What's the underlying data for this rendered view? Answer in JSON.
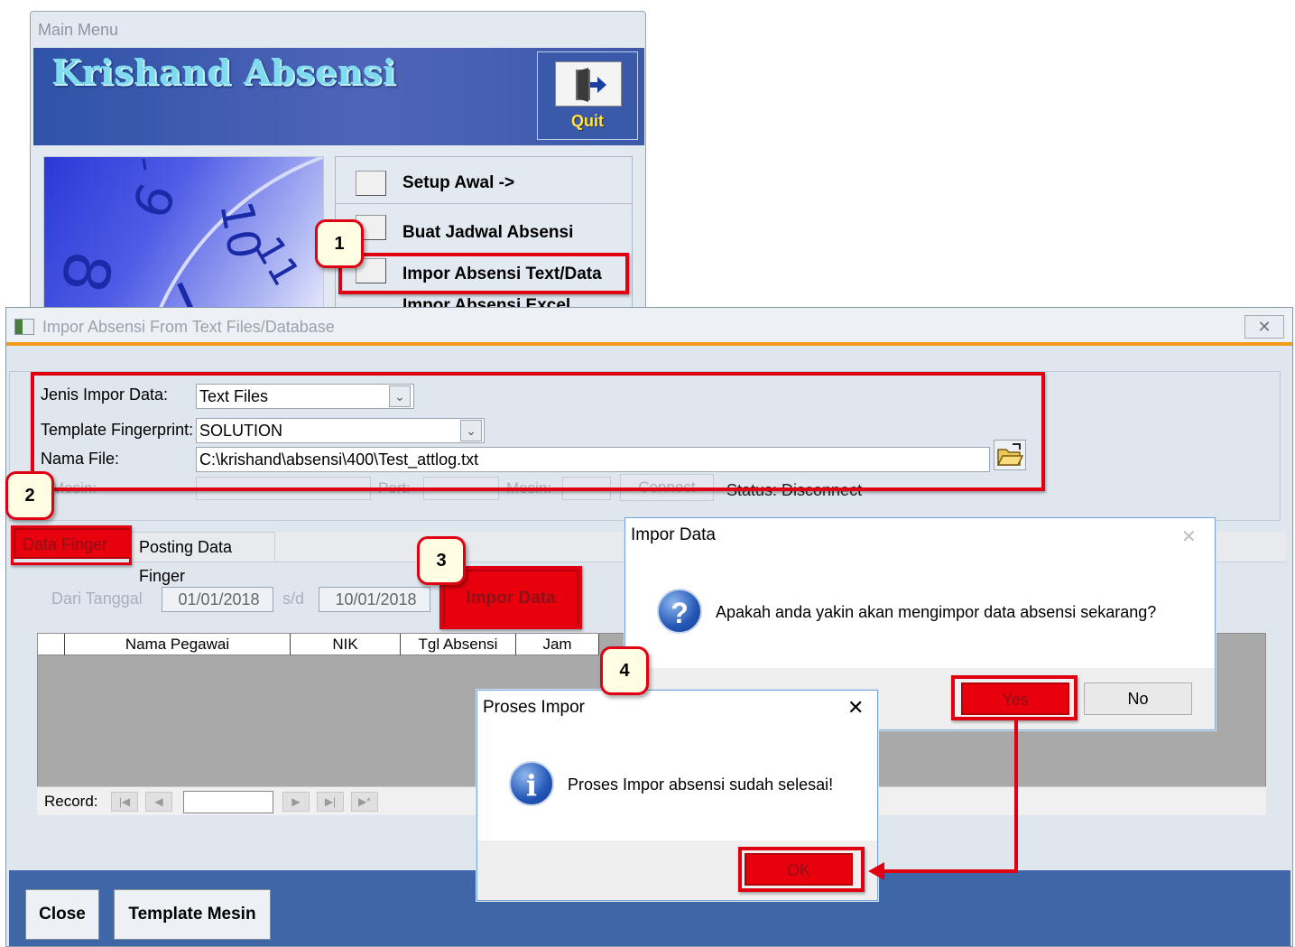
{
  "main_menu": {
    "title": "Main Menu",
    "brand": "Krishand Absensi",
    "quit_label": "Quit",
    "items": [
      {
        "label": "Setup Awal ->"
      },
      {
        "label": "Buat Jadwal Absensi"
      },
      {
        "label": "Impor Absensi Text/Data"
      },
      {
        "label": "Impor Absensi Excel"
      }
    ],
    "clock_digits": [
      "9",
      "10",
      "11",
      "8"
    ]
  },
  "impor_window": {
    "title": "Impor Absensi From Text Files/Database",
    "close_glyph": "✕",
    "jenis_label": "Jenis Impor Data:",
    "jenis_value": "Text Files",
    "template_label": "Template Fingerprint:",
    "template_value": "SOLUTION",
    "nama_file_label": "Nama File:",
    "nama_file_value": "C:\\krishand\\absensi\\400\\Test_attlog.txt",
    "mesin_label": "Mesin:",
    "port_label": "Port:",
    "mesin2_label": "Mesin:",
    "connect_label": "Connect",
    "status_text": "Status: Disconnect",
    "tabs": [
      {
        "label": "Data Finger"
      },
      {
        "label": "Posting Data Finger"
      }
    ],
    "dari_tanggal_label": "Dari Tanggal",
    "dari_tanggal_value": "01/01/2018",
    "sd_label": "s/d",
    "sampai_tanggal_value": "10/01/2018",
    "impor_button": "Impor Data",
    "columns": [
      "Nama Pegawai",
      "NIK",
      "Tgl Absensi",
      "Jam"
    ],
    "record_label": "Record:",
    "nav_icons": [
      "first-record-icon",
      "prev-record-icon",
      "next-record-icon",
      "last-record-icon",
      "new-record-icon"
    ],
    "nav_glyphs": {
      "first": "|◀",
      "prev": "◀",
      "next": "▶",
      "last": "▶|",
      "new": "▶*"
    },
    "close_button": "Close",
    "template_mesin_button": "Template Mesin"
  },
  "confirm_dialog": {
    "title": "Impor Data",
    "close_glyph": "✕",
    "icon": "question-icon",
    "icon_glyph": "?",
    "message": "Apakah anda yakin akan mengimpor data absensi sekarang?",
    "yes": "Yes",
    "no": "No"
  },
  "done_dialog": {
    "title": "Proses Impor",
    "close_glyph": "✕",
    "icon": "info-icon",
    "icon_glyph": "i",
    "message": "Proses Impor absensi sudah selesai!",
    "ok": "OK"
  },
  "steps": [
    "1",
    "2",
    "3",
    "4"
  ],
  "colors": {
    "annotation_red": "#e00012",
    "window_accent": "#f39a1b",
    "banner_blue": "#2f53a8",
    "bottom_bar_blue": "#3f66a7"
  }
}
